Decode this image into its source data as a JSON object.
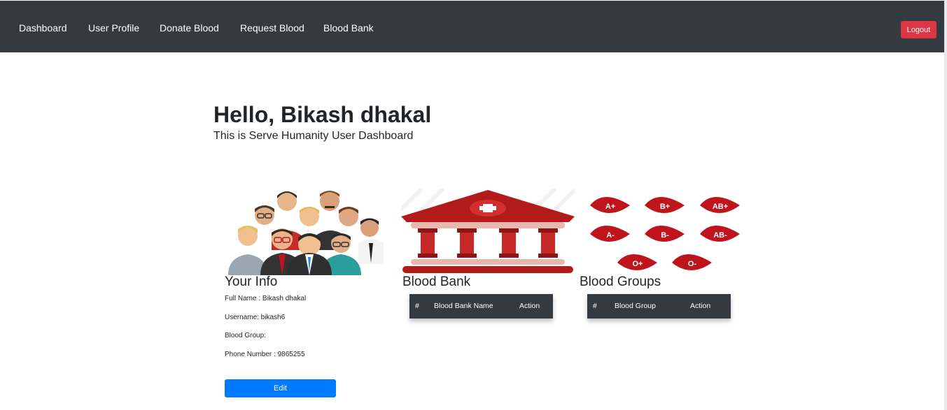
{
  "nav": {
    "items": [
      "Dashboard",
      "User Profile",
      "Donate Blood",
      "Request Blood",
      "Blood Bank"
    ],
    "logout_label": "Logout"
  },
  "header": {
    "greeting": "Hello, Bikash dhakal",
    "subtitle": "This is Serve Humanity User Dashboard"
  },
  "info": {
    "title": "Your Info",
    "full_name": "Full Name : Bikash dhakal",
    "username": "Username: bikash6",
    "blood_group": "Blood Group:",
    "phone": "Phone Number : 9865255",
    "edit_label": "Edit"
  },
  "blood_bank": {
    "title": "Blood Bank",
    "columns": [
      "#",
      "Blood Bank Name",
      "Action"
    ]
  },
  "blood_groups": {
    "title": "Blood Groups",
    "columns": [
      "#",
      "Blood Group",
      "Action"
    ],
    "drop_labels": [
      "A+",
      "B+",
      "AB+",
      "A-",
      "B-",
      "AB-",
      "O+",
      "O-"
    ]
  },
  "colors": {
    "navbar": "#343a40",
    "logout": "#dc3545",
    "edit": "#007bff",
    "blood": "#c0141c"
  }
}
